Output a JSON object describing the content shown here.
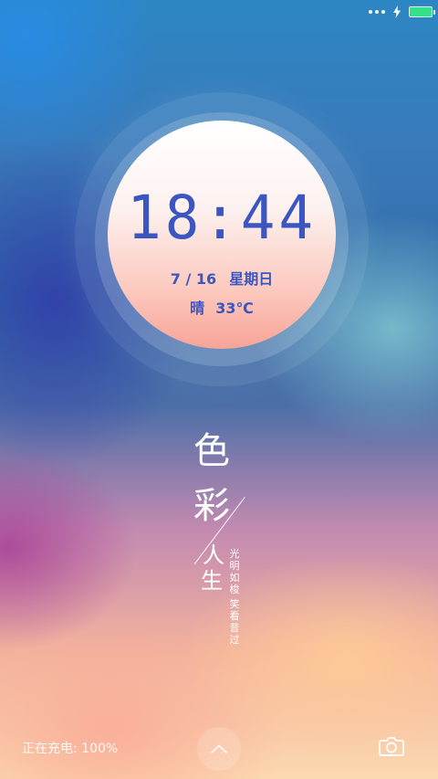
{
  "status_bar": {
    "more_icon": "more-dots-icon",
    "charging_icon": "charging-bolt-icon",
    "battery_icon": "battery-icon",
    "battery_color": "#34e08a",
    "battery_level": 1.0
  },
  "clock": {
    "time": "18:44",
    "date_day": "7 / 16",
    "weekday": "星期日",
    "weather": "晴",
    "temperature": "33℃",
    "text_color": "#3b56c0"
  },
  "artwork": {
    "char_1": "色",
    "char_2": "彩",
    "char_3": "人",
    "char_4": "生",
    "vertical_1": "光明如梭",
    "vertical_2": "笑看昔过"
  },
  "bottom": {
    "charging_text": "正在充电: 100%",
    "swipe_icon": "chevron-up-icon",
    "camera_icon": "camera-icon"
  }
}
